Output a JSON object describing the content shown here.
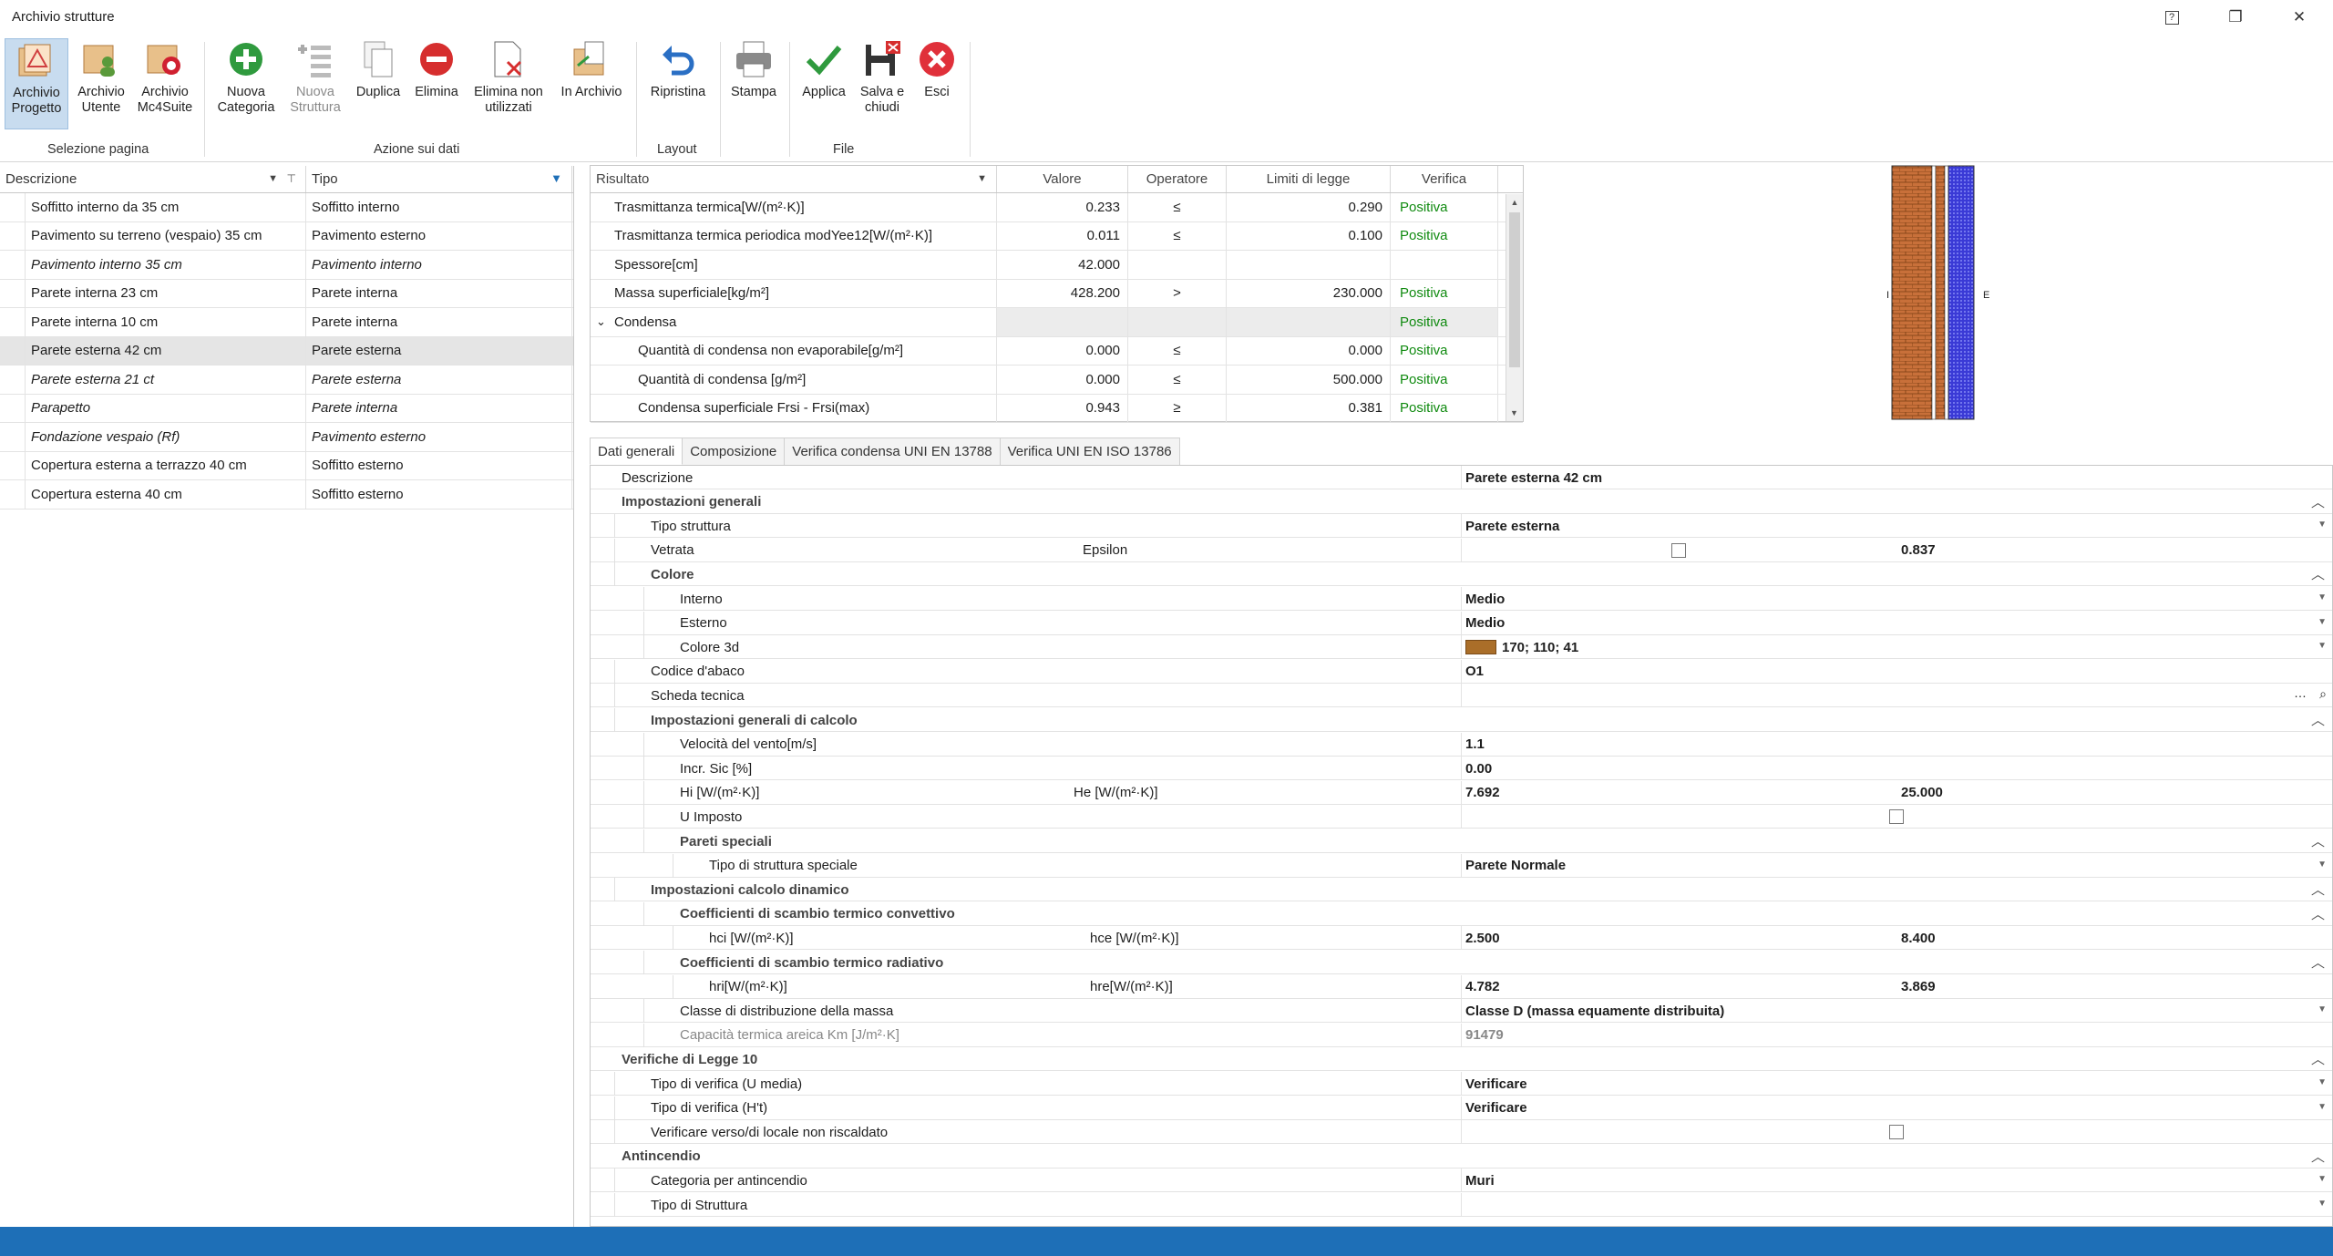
{
  "window": {
    "title": "Archivio strutture",
    "help_glyph": "?",
    "restore_glyph": "❐",
    "close_glyph": "✕"
  },
  "ribbon": {
    "buttons": [
      {
        "line1": "Archivio",
        "line2": "Progetto",
        "icon": "folder-project-icon",
        "active": true
      },
      {
        "line1": "Archivio",
        "line2": "Utente",
        "icon": "folder-user-icon"
      },
      {
        "line1": "Archivio",
        "line2": "Mc4Suite",
        "icon": "folder-mc4suite-icon"
      },
      {
        "line1": "Nuova",
        "line2": "Categoria",
        "icon": "add-category-icon"
      },
      {
        "line1": "Nuova",
        "line2": "Struttura",
        "icon": "add-structure-icon",
        "disabled": true
      },
      {
        "line1": "Duplica",
        "line2": "",
        "icon": "duplicate-icon"
      },
      {
        "line1": "Elimina",
        "line2": "",
        "icon": "delete-icon"
      },
      {
        "line1": "Elimina non",
        "line2": "utilizzati",
        "icon": "delete-unused-icon"
      },
      {
        "line1": "In Archivio",
        "line2": "",
        "icon": "to-archive-icon"
      },
      {
        "line1": "Ripristina",
        "line2": "",
        "icon": "restore-icon"
      },
      {
        "line1": "Stampa",
        "line2": "",
        "icon": "printer-icon"
      },
      {
        "line1": "Applica",
        "line2": "",
        "icon": "check-icon"
      },
      {
        "line1": "Salva e",
        "line2": "chiudi",
        "icon": "save-close-icon"
      },
      {
        "line1": "Esci",
        "line2": "",
        "icon": "exit-icon"
      }
    ],
    "groups": [
      "Selezione pagina",
      "Azione sui dati",
      "Layout",
      "File"
    ]
  },
  "left_grid": {
    "columns": [
      "Descrizione",
      "Tipo"
    ],
    "rows": [
      {
        "desc": "Soffitto interno da 35 cm",
        "tipo": "Soffitto interno"
      },
      {
        "desc": "Pavimento su terreno (vespaio) 35 cm",
        "tipo": "Pavimento esterno"
      },
      {
        "desc": "Pavimento interno 35 cm",
        "tipo": "Pavimento interno",
        "italic": true
      },
      {
        "desc": "Parete interna 23 cm",
        "tipo": "Parete interna"
      },
      {
        "desc": "Parete interna 10 cm",
        "tipo": "Parete interna"
      },
      {
        "desc": "Parete esterna 42 cm",
        "tipo": "Parete esterna",
        "selected": true
      },
      {
        "desc": "Parete esterna 21 ct",
        "tipo": "Parete esterna",
        "italic": true
      },
      {
        "desc": "Parapetto",
        "tipo": "Parete interna",
        "italic": true
      },
      {
        "desc": "Fondazione vespaio (Rf)",
        "tipo": "Pavimento esterno",
        "italic": true
      },
      {
        "desc": "Copertura esterna a terrazzo 40 cm",
        "tipo": "Soffitto esterno"
      },
      {
        "desc": "Copertura esterna 40 cm",
        "tipo": "Soffitto esterno"
      }
    ]
  },
  "results": {
    "columns": [
      "Risultato",
      "Valore",
      "Operatore",
      "Limiti di legge",
      "Verifica"
    ],
    "rows": [
      {
        "label": "Trasmittanza termica[W/(m²·K)]",
        "value": "0.233",
        "op": "≤",
        "limit": "0.290",
        "check": "Positiva",
        "indent": 0
      },
      {
        "label": "Trasmittanza termica periodica modYee12[W/(m²·K)]",
        "value": "0.011",
        "op": "≤",
        "limit": "0.100",
        "check": "Positiva",
        "indent": 0
      },
      {
        "label": "Spessore[cm]",
        "value": "42.000",
        "op": "",
        "limit": "",
        "check": "",
        "indent": 0
      },
      {
        "label": "Massa superficiale[kg/m²]",
        "value": "428.200",
        "op": ">",
        "limit": "230.000",
        "check": "Positiva",
        "indent": 0
      },
      {
        "label": "Condensa",
        "value": "",
        "op": "",
        "limit": "",
        "check": "Positiva",
        "indent": 0,
        "group": true
      },
      {
        "label": "Quantità di condensa non evaporabile[g/m²]",
        "value": "0.000",
        "op": "≤",
        "limit": "0.000",
        "check": "Positiva",
        "indent": 1
      },
      {
        "label": "Quantità di condensa [g/m²]",
        "value": "0.000",
        "op": "≤",
        "limit": "500.000",
        "check": "Positiva",
        "indent": 1
      },
      {
        "label": "Condensa superficiale Frsi - Frsi(max)",
        "value": "0.943",
        "op": "≥",
        "limit": "0.381",
        "check": "Positiva",
        "indent": 1
      }
    ]
  },
  "wall_labels": {
    "inside": "I",
    "outside": "E"
  },
  "tabs": [
    "Dati generali",
    "Composizione",
    "Verifica condensa  UNI EN 13788",
    "Verifica UNI EN ISO 13786"
  ],
  "props": [
    {
      "label": "Descrizione",
      "lvl": 0,
      "v1": "Parete esterna 42 cm",
      "plain": true
    },
    {
      "label": "Impostazioni generali",
      "lvl": 0,
      "cat": true
    },
    {
      "label": "Tipo struttura",
      "lvl": 1,
      "v1": "Parete esterna",
      "dd": true
    },
    {
      "label": "Vetrata",
      "lvl": 1,
      "l2": "Epsilon",
      "cb1": true,
      "v2": "0.837"
    },
    {
      "label": "Colore",
      "lvl": 1,
      "cat": true
    },
    {
      "label": "Interno",
      "lvl": 2,
      "v1": "Medio",
      "dd": true
    },
    {
      "label": "Esterno",
      "lvl": 2,
      "v1": "Medio",
      "dd": true
    },
    {
      "label": "Colore 3d",
      "lvl": 2,
      "v1": "170; 110; 41",
      "swatch": "#aa6e29",
      "dd": true
    },
    {
      "label": "Codice d'abaco",
      "lvl": 1,
      "v1": "O1"
    },
    {
      "label": "Scheda tecnica",
      "lvl": 1,
      "v1": "",
      "browse": true
    },
    {
      "label": "Impostazioni generali di calcolo",
      "lvl": 1,
      "cat": true
    },
    {
      "label": "Velocità del vento[m/s]",
      "lvl": 2,
      "v1": "1.1"
    },
    {
      "label": "Incr. Sic [%]",
      "lvl": 2,
      "v1": "0.00"
    },
    {
      "label": "Hi [W/(m²·K)]",
      "lvl": 2,
      "l2": "He [W/(m²·K)]",
      "v1": "7.692",
      "v2": "25.000"
    },
    {
      "label": "U Imposto",
      "lvl": 2,
      "cb2": true
    },
    {
      "label": "Pareti speciali",
      "lvl": 2,
      "cat": true
    },
    {
      "label": "Tipo di struttura speciale",
      "lvl": 3,
      "v1": "Parete Normale",
      "dd": true
    },
    {
      "label": "Impostazioni calcolo dinamico",
      "lvl": 1,
      "cat": true
    },
    {
      "label": "Coefficienti di scambio termico convettivo",
      "lvl": 2,
      "cat": true
    },
    {
      "label": "hci [W/(m²·K)]",
      "lvl": 3,
      "l2": "hce [W/(m²·K)]",
      "v1": "2.500",
      "v2": "8.400"
    },
    {
      "label": "Coefficienti di scambio termico radiativo",
      "lvl": 2,
      "cat": true
    },
    {
      "label": "hri[W/(m²·K)]",
      "lvl": 3,
      "l2": "hre[W/(m²·K)]",
      "v1": "4.782",
      "v2": "3.869"
    },
    {
      "label": "Classe di distribuzione della massa",
      "lvl": 2,
      "v1": "Classe D (massa equamente distribuita)",
      "dd": true
    },
    {
      "label": "Capacità termica areica Km [J/m²·K]",
      "lvl": 2,
      "v1": "91479",
      "dim": true
    },
    {
      "label": "Verifiche di Legge 10",
      "lvl": 0,
      "cat": true
    },
    {
      "label": "Tipo di verifica (U media)",
      "lvl": 1,
      "v1": "Verificare",
      "dd": true
    },
    {
      "label": "Tipo di verifica (H't)",
      "lvl": 1,
      "v1": "Verificare",
      "dd": true
    },
    {
      "label": "Verificare verso/di locale non riscaldato",
      "lvl": 1,
      "cb2": true
    },
    {
      "label": "Antincendio",
      "lvl": 0,
      "cat": true
    },
    {
      "label": "Categoria per antincendio",
      "lvl": 1,
      "v1": "Muri",
      "dd": true
    },
    {
      "label": "Tipo di Struttura",
      "lvl": 1,
      "v1": "",
      "dd": true
    }
  ],
  "colors": {
    "accent": "#1e6fb7",
    "positive": "#0f8a0f",
    "brick": "#c8703a",
    "insulation": "#3a3ad6"
  }
}
